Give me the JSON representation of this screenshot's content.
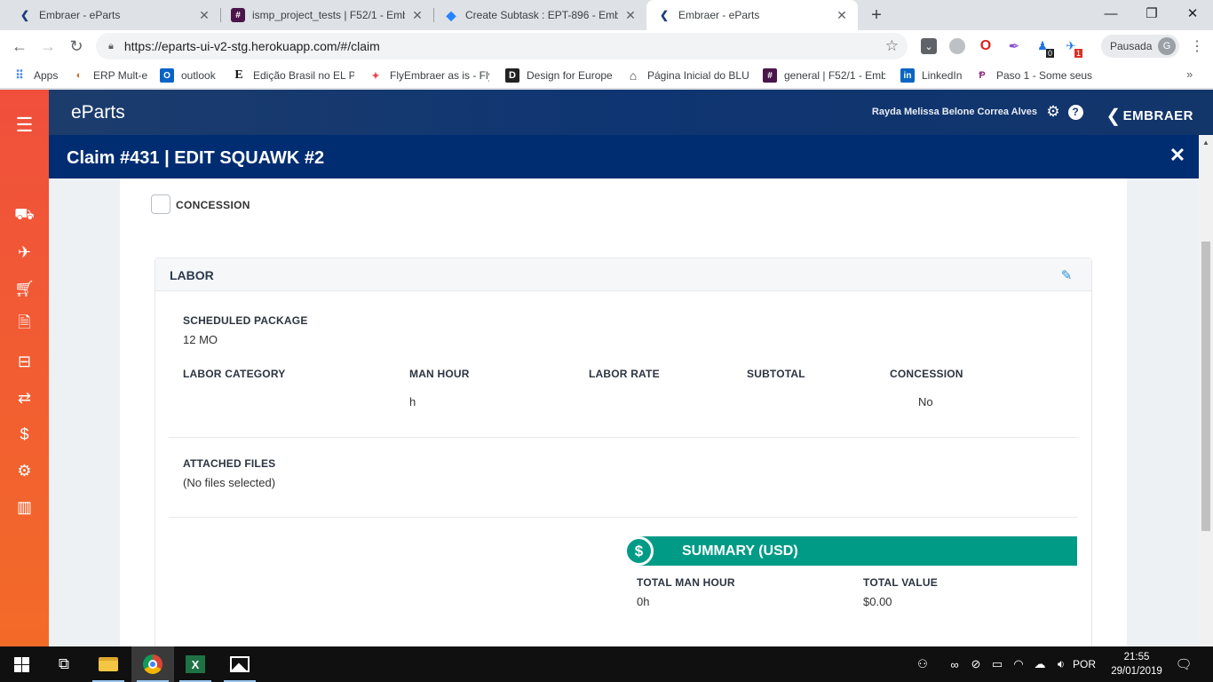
{
  "browser": {
    "tabs": [
      {
        "title": "Embraer - eParts",
        "icon": "embraer-chevron-icon"
      },
      {
        "title": "ismp_project_tests | F52/1 - Embr",
        "icon": "slack-icon"
      },
      {
        "title": "Create Subtask : EPT-896 - Embra",
        "icon": "jira-icon"
      },
      {
        "title": "Embraer - eParts",
        "icon": "embraer-chevron-icon"
      }
    ],
    "url": "https://eparts-ui-v2-stg.herokuapp.com/#/claim",
    "profile_label": "Pausada",
    "profile_initial": "G",
    "ext_badge_1": "0",
    "ext_badge_2": "1"
  },
  "bookmarks": [
    "Apps",
    "ERP Mult-e",
    "outlook",
    "Edição Brasil no EL PA",
    "FlyEmbraer as is - Fly",
    "Design for Europe",
    "Página Inicial do BLU",
    "general | F52/1 - Emb",
    "LinkedIn",
    "Paso 1 - Some seus p"
  ],
  "app": {
    "logo": "eParts",
    "user_name": "Rayda Melissa Belone Correa Alves",
    "brand": "EMBRAER",
    "accent_color": "#f04f3c",
    "header_color": "#0f3572"
  },
  "modal": {
    "title": "Claim #431 | EDIT SQUAWK #2",
    "concession_label": "CONCESSION",
    "labor": {
      "title": "LABOR",
      "scheduled_package_label": "SCHEDULED PACKAGE",
      "scheduled_package_value": "12 MO",
      "columns": {
        "labor_category": "LABOR CATEGORY",
        "man_hour": "MAN HOUR",
        "labor_rate": "LABOR RATE",
        "subtotal": "SUBTOTAL",
        "concession": "CONCESSION"
      },
      "row": {
        "labor_category": "",
        "man_hour": "h",
        "labor_rate": "",
        "subtotal": "",
        "concession": "No"
      },
      "attached_files_label": "ATTACHED FILES",
      "attached_files_value": "(No files selected)"
    },
    "summary": {
      "title": "SUMMARY (USD)",
      "icon": "$",
      "total_man_hour_label": "TOTAL MAN HOUR",
      "total_man_hour_value": "0h",
      "total_value_label": "TOTAL VALUE",
      "total_value_value": "$0.00",
      "color": "#009b87"
    }
  },
  "taskbar": {
    "language": "POR",
    "time": "21:55",
    "date": "29/01/2019"
  }
}
